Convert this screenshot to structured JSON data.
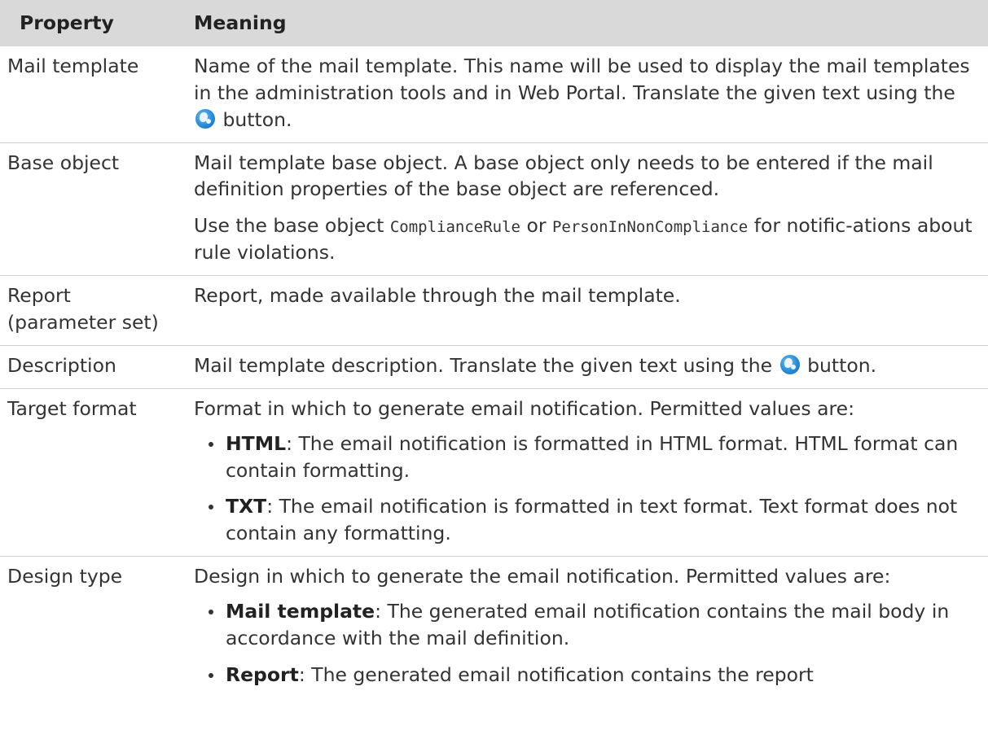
{
  "table": {
    "header": {
      "property": "Property",
      "meaning": "Meaning"
    },
    "rows": [
      {
        "property": "Mail template",
        "paras": [
          {
            "before": "Name of the mail template. This name will be used to display the mail templates in the administration tools and in Web Portal. Translate the given text using the",
            "icon": "globe-icon",
            "after": "button."
          }
        ]
      },
      {
        "property": "Base object",
        "paras": [
          {
            "text": "Mail template base object. A base object only needs to be entered if the mail definition properties of the base object are referenced."
          },
          {
            "text_a": "Use the base object",
            "code_1": "ComplianceRule",
            "text_b": "or",
            "code_2": "PersonInNonCompliance",
            "text_c": "for notific-ations about rule violations."
          }
        ]
      },
      {
        "property": "Report (parameter set)",
        "paras": [
          {
            "text": "Report, made available through the mail template."
          }
        ]
      },
      {
        "property": "Description",
        "paras": [
          {
            "before": "Mail template description. Translate the given text using the",
            "icon": "globe-icon",
            "after": "button."
          }
        ]
      },
      {
        "property": "Target format",
        "intro": "Format in which to generate email notification. Permitted values are:",
        "bullets": [
          {
            "term": "HTML",
            "text": ": The email notification is formatted in HTML format. HTML format can contain formatting."
          },
          {
            "term": "TXT",
            "text": ": The email notification is formatted in text format. Text format does not contain any formatting."
          }
        ]
      },
      {
        "property": "Design type",
        "intro": "Design in which to generate the email notification. Permitted values are:",
        "bullets": [
          {
            "term": "Mail template",
            "text": ": The generated email notification contains the mail body in accordance with the mail definition."
          },
          {
            "term": "Report",
            "text": ": The generated email notification contains the report"
          }
        ]
      }
    ]
  }
}
